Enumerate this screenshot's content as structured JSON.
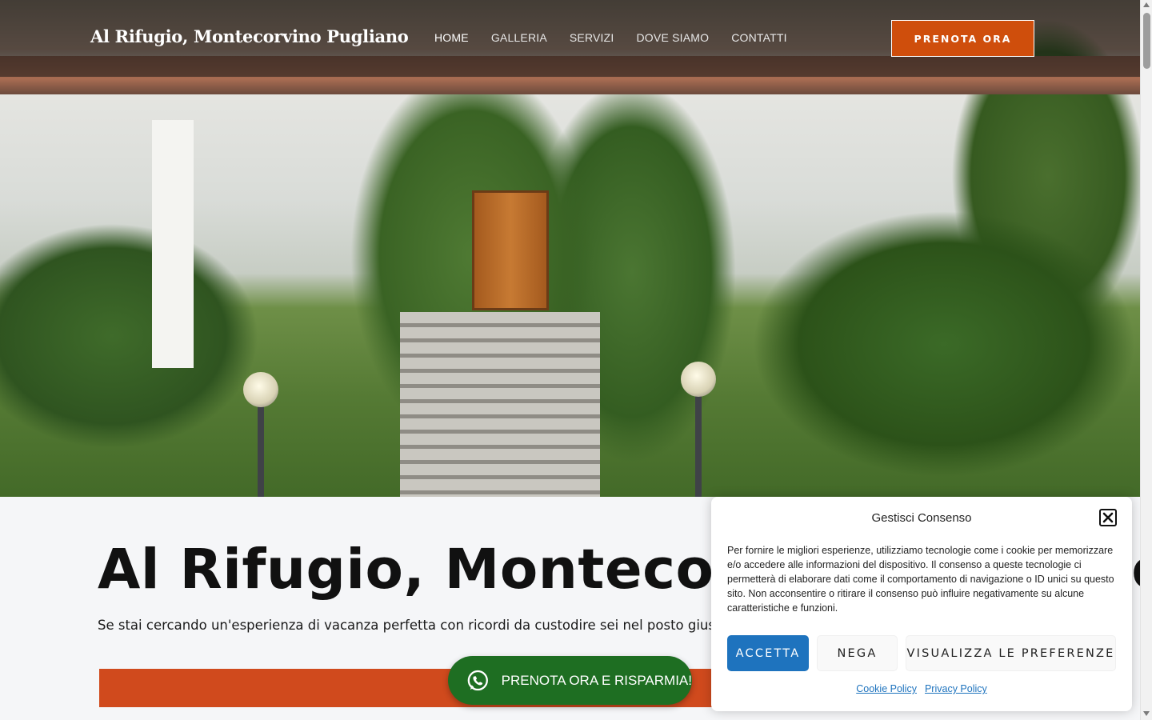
{
  "header": {
    "brand": "Al Rifugio, Montecorvino Pugliano",
    "nav": [
      {
        "label": "HOME"
      },
      {
        "label": "GALLERIA"
      },
      {
        "label": "SERVIZI"
      },
      {
        "label": "DOVE SIAMO"
      },
      {
        "label": "CONTATTI"
      }
    ],
    "cta_label": "PRENOTA ORA"
  },
  "main": {
    "title": "Al Rifugio, Montecorvino Pugliano",
    "subtitle": "Se stai cercando un'esperienza di vacanza perfetta con ricordi da custodire sei nel posto giusto"
  },
  "whatsapp": {
    "label": "PRENOTA ORA E RISPARMIA!",
    "icon": "whatsapp-icon"
  },
  "consent": {
    "title": "Gestisci Consenso",
    "text": "Per fornire le migliori esperienze, utilizziamo tecnologie come i cookie per memorizzare e/o accedere alle informazioni del dispositivo. Il consenso a queste tecnologie ci permetterà di elaborare dati come il comportamento di navigazione o ID unici su questo sito. Non acconsentire o ritirare il consenso può influire negativamente su alcune caratteristiche e funzioni.",
    "accept_label": "ACCETTA",
    "deny_label": "NEGA",
    "prefs_label": "VISUALIZZA LE PREFERENZE",
    "cookie_policy": "Cookie Policy",
    "privacy_policy": "Privacy Policy"
  },
  "colors": {
    "accent_orange": "#cf4e0c",
    "bar_orange": "#d04a1d",
    "whatsapp_green": "#1e6e22",
    "accept_blue": "#1e73be"
  }
}
